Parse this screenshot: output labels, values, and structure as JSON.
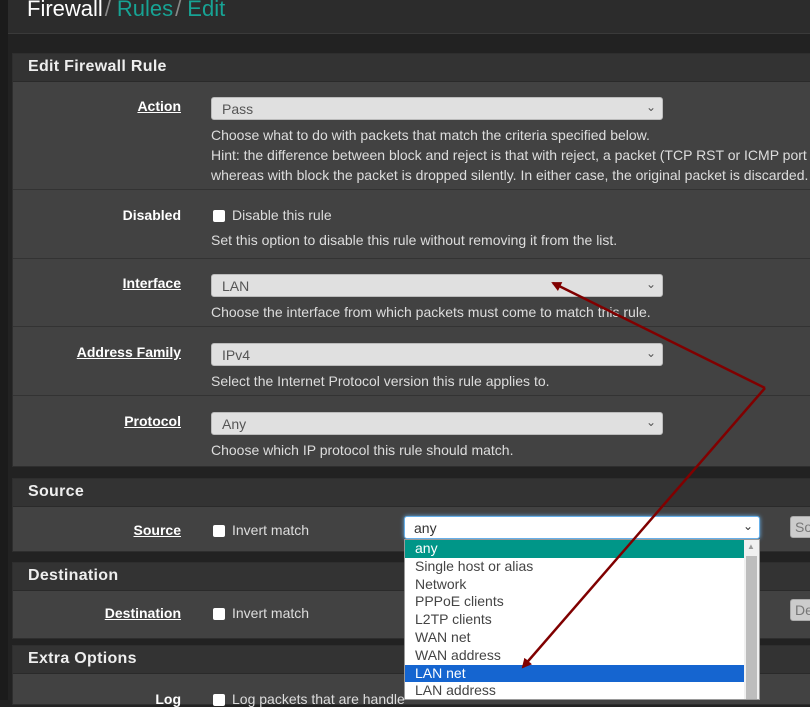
{
  "breadcrumb": {
    "root": "Firewall",
    "rules": "Rules",
    "edit": "Edit"
  },
  "panels": {
    "edit": {
      "title": "Edit Firewall Rule",
      "action": {
        "label": "Action",
        "value": "Pass",
        "help1": "Choose what to do with packets that match the criteria specified below.",
        "help2": "Hint: the difference between block and reject is that with reject, a packet (TCP RST or ICMP port u",
        "help3": "whereas with block the packet is dropped silently. In either case, the original packet is discarded."
      },
      "disabled": {
        "label": "Disabled",
        "checkbox": "Disable this rule",
        "help": "Set this option to disable this rule without removing it from the list."
      },
      "interface": {
        "label": "Interface",
        "value": "LAN",
        "help": "Choose the interface from which packets must come to match this rule."
      },
      "address_family": {
        "label": "Address Family",
        "value": "IPv4",
        "help": "Select the Internet Protocol version this rule applies to."
      },
      "protocol": {
        "label": "Protocol",
        "value": "Any",
        "help": "Choose which IP protocol this rule should match."
      }
    },
    "source": {
      "title": "Source",
      "label": "Source",
      "invert": "Invert match",
      "value": "any",
      "button": "So",
      "options": [
        "any",
        "Single host or alias",
        "Network",
        "PPPoE clients",
        "L2TP clients",
        "WAN net",
        "WAN address",
        "LAN net",
        "LAN address"
      ],
      "selected": "any",
      "highlighted": "LAN net"
    },
    "destination": {
      "title": "Destination",
      "label": "Destination",
      "invert": "Invert match",
      "button": "De"
    },
    "extra": {
      "title": "Extra Options",
      "log_label": "Log",
      "log_checkbox": "Log packets that are handle"
    }
  },
  "annotation": {
    "arrow_color": "#800000"
  }
}
